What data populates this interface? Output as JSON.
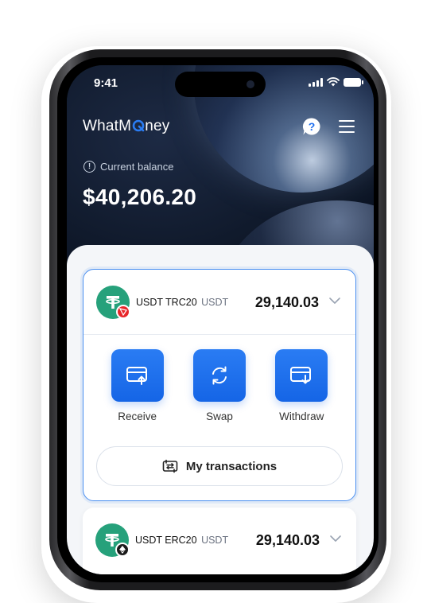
{
  "status_bar": {
    "time": "9:41"
  },
  "header": {
    "brand": "WhatMoney",
    "brand_pre": "WhatM",
    "brand_post": "ney",
    "help_icon": "help-bubble-icon",
    "menu_icon": "hamburger-menu-icon"
  },
  "balance": {
    "label": "Current balance",
    "value": "$40,206.20"
  },
  "wallets": [
    {
      "name": "USDT TRC20",
      "unit": "USDT",
      "amount": "29,140.03",
      "chain": "TRON"
    },
    {
      "name": "USDT ERC20",
      "unit": "USDT",
      "amount": "29,140.03",
      "chain": "Ethereum"
    }
  ],
  "actions": {
    "receive": "Receive",
    "swap": "Swap",
    "withdraw": "Withdraw"
  },
  "transactions_button": "My transactions",
  "colors": {
    "accent": "#1f6fef",
    "tether_green": "#26a17b",
    "tron_red": "#e8262a",
    "header_bg": "#0f1b2e"
  }
}
